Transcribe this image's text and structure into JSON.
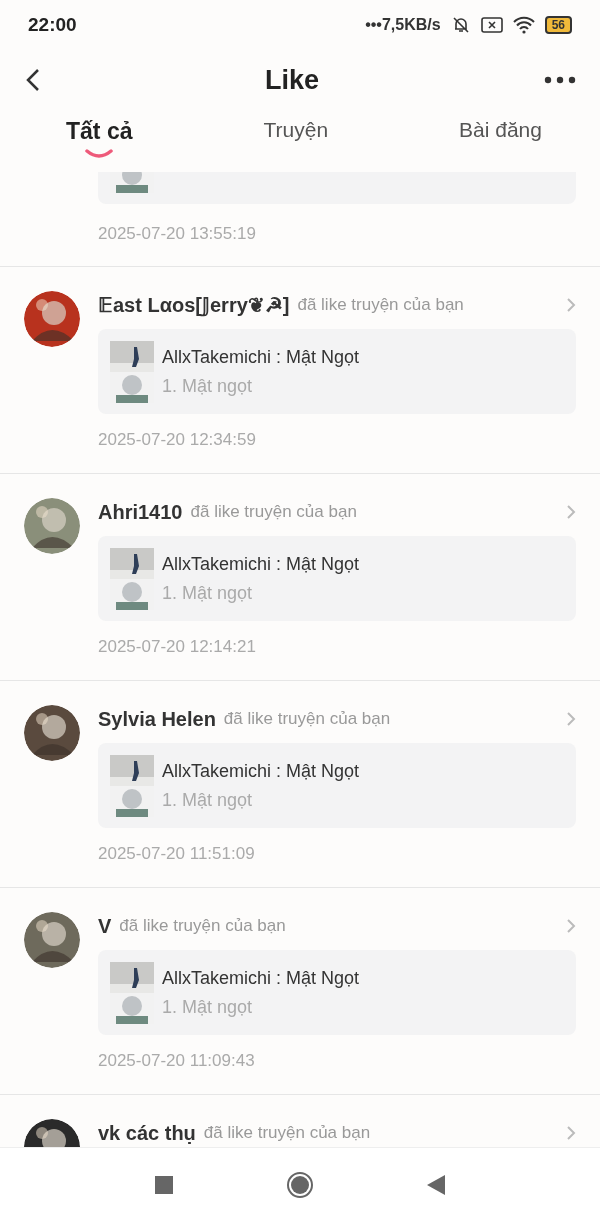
{
  "status_bar": {
    "time": "22:00",
    "speed": "•••7,5KB/s",
    "battery": "56"
  },
  "header": {
    "title": "Like"
  },
  "tabs": [
    {
      "label": "Tất cả",
      "selected": true
    },
    {
      "label": "Truyện",
      "selected": false
    },
    {
      "label": "Bài đăng",
      "selected": false
    }
  ],
  "partial_item": {
    "time": "2025-07-20 13:55:19"
  },
  "items": [
    {
      "user": "𝔼ast Lαos[𝕁erry❦☭]",
      "action": "đã like truyện của bạn",
      "story": "AllxTakemichi : Mật Ngọt",
      "chapter": "1. Mật ngọt",
      "time": "2025-07-20 12:34:59"
    },
    {
      "user": "Ahri1410",
      "action": "đã like truyện của bạn",
      "story": "AllxTakemichi : Mật Ngọt",
      "chapter": "1. Mật ngọt",
      "time": "2025-07-20 12:14:21"
    },
    {
      "user": "Sylvia Helen",
      "action": "đã like truyện của bạn",
      "story": "AllxTakemichi : Mật Ngọt",
      "chapter": "1. Mật ngọt",
      "time": "2025-07-20 11:51:09"
    },
    {
      "user": "V",
      "action": "đã like truyện của bạn",
      "story": "AllxTakemichi : Mật Ngọt",
      "chapter": "1. Mật ngọt",
      "time": "2025-07-20 11:09:43"
    },
    {
      "user": "vk các thụ",
      "action": "đã like truyện của bạn"
    }
  ]
}
